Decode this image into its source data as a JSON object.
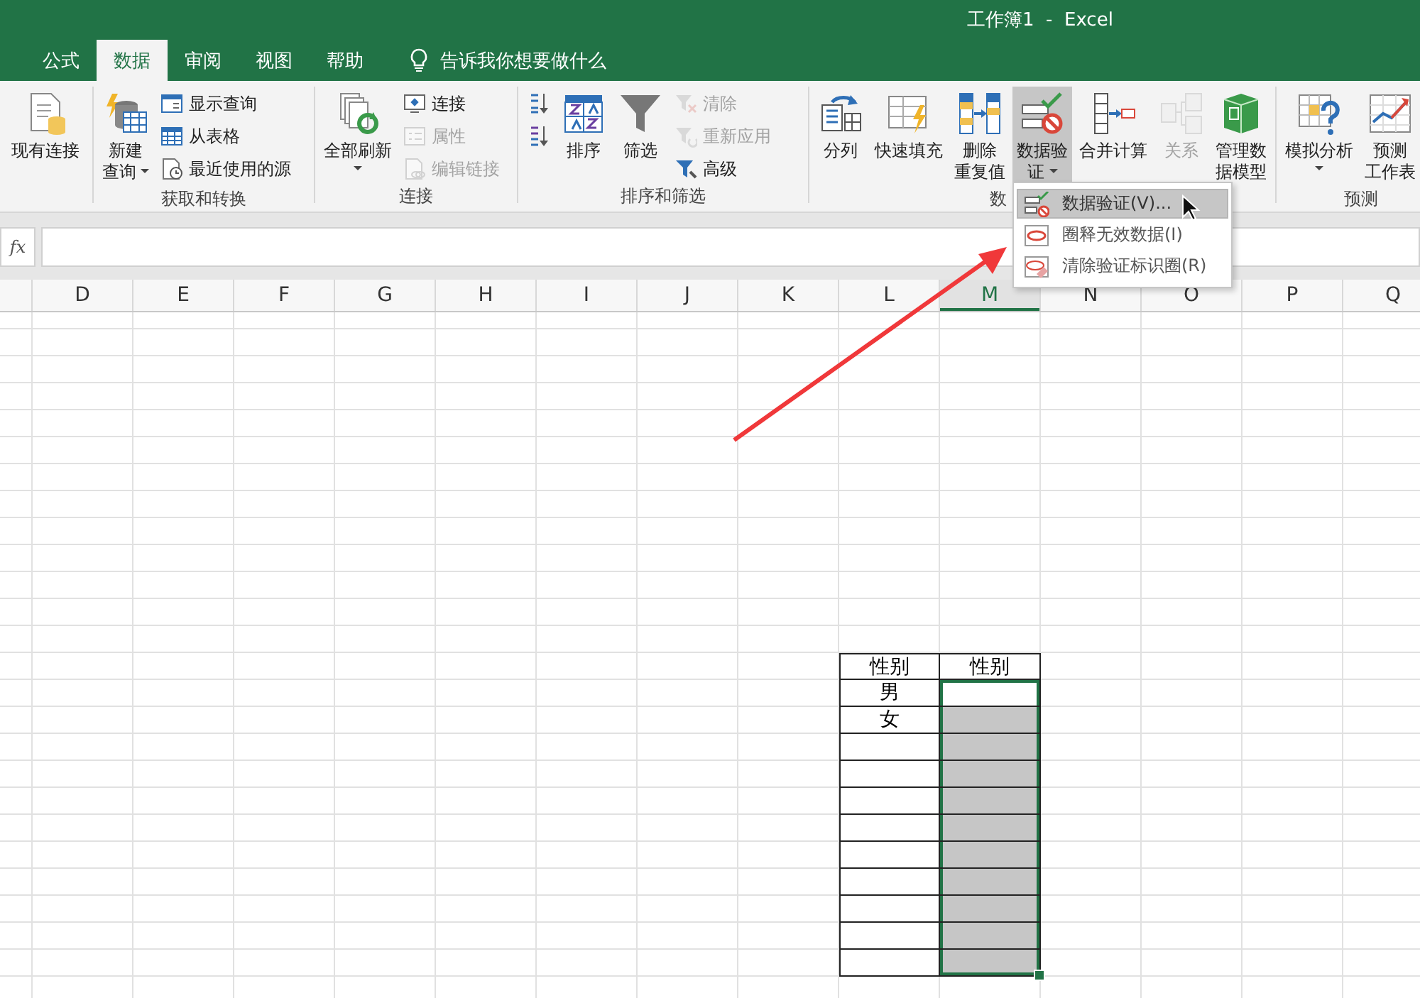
{
  "window": {
    "title": "工作簿1  -  Excel"
  },
  "tabs": [
    {
      "label": "公式",
      "selected": false
    },
    {
      "label": "数据",
      "selected": true
    },
    {
      "label": "审阅",
      "selected": false
    },
    {
      "label": "视图",
      "selected": false
    },
    {
      "label": "帮助",
      "selected": false
    }
  ],
  "tell_me": {
    "label": "告诉我你想要做什么"
  },
  "ribbon": {
    "groups": [
      {
        "items": [
          {
            "kind": "large",
            "lines": [
              "现有连接"
            ],
            "disabled": false,
            "pressed": false
          }
        ]
      },
      {
        "label": "获取和转换",
        "items": [
          {
            "kind": "large",
            "lines": [
              "新建",
              "查询"
            ],
            "dropdown": true,
            "disabled": false,
            "pressed": false
          },
          {
            "kind": "small",
            "label": "显示查询",
            "disabled": false,
            "pressed": false
          },
          {
            "kind": "small",
            "label": "从表格",
            "disabled": false,
            "pressed": false
          },
          {
            "kind": "small",
            "label": "最近使用的源",
            "disabled": false,
            "pressed": false
          }
        ]
      },
      {
        "label": "连接",
        "items": [
          {
            "kind": "large",
            "lines": [
              "全部刷新"
            ],
            "dropdown": true,
            "disabled": false,
            "pressed": false
          },
          {
            "kind": "small",
            "label": "连接",
            "disabled": false,
            "pressed": false
          },
          {
            "kind": "small",
            "label": "属性",
            "disabled": true,
            "pressed": false
          },
          {
            "kind": "small",
            "label": "编辑链接",
            "disabled": true,
            "pressed": false
          }
        ]
      },
      {
        "label": "排序和筛选",
        "items": [
          {
            "kind": "small",
            "disabled": false,
            "pressed": false
          },
          {
            "kind": "small",
            "disabled": false,
            "pressed": false
          },
          {
            "kind": "large",
            "lines": [
              "排序"
            ],
            "disabled": false,
            "pressed": false
          },
          {
            "kind": "large",
            "lines": [
              "筛选"
            ],
            "disabled": false,
            "pressed": false
          },
          {
            "kind": "small",
            "label": "清除",
            "disabled": true,
            "pressed": false
          },
          {
            "kind": "small",
            "label": "重新应用",
            "disabled": true,
            "pressed": false
          },
          {
            "kind": "small",
            "label": "高级",
            "disabled": false,
            "pressed": false
          }
        ]
      },
      {
        "label": "数",
        "items": [
          {
            "kind": "large",
            "lines": [
              "分列"
            ],
            "disabled": false,
            "pressed": false
          },
          {
            "kind": "large",
            "lines": [
              "快速填充"
            ],
            "disabled": false,
            "pressed": false
          },
          {
            "kind": "large",
            "lines": [
              "删除",
              "重复值"
            ],
            "disabled": false,
            "pressed": false
          },
          {
            "kind": "large",
            "lines": [
              "数据验",
              "证"
            ],
            "dropdown": true,
            "disabled": false,
            "pressed": true
          },
          {
            "kind": "large",
            "lines": [
              "合并计算"
            ],
            "disabled": false,
            "pressed": false
          },
          {
            "kind": "large",
            "lines": [
              "关系"
            ],
            "disabled": true,
            "pressed": false
          },
          {
            "kind": "large",
            "lines": [
              "管理数",
              "据模型"
            ],
            "disabled": false,
            "pressed": false
          }
        ]
      },
      {
        "label": "预测",
        "items": [
          {
            "kind": "large",
            "lines": [
              "模拟分析"
            ],
            "dropdown": true,
            "disabled": false,
            "pressed": false
          },
          {
            "kind": "large",
            "lines": [
              "预测",
              "工作表"
            ],
            "disabled": false,
            "pressed": false
          }
        ]
      }
    ]
  },
  "formula_bar": {
    "label": "fx"
  },
  "columns": [
    {
      "label": "D",
      "selected": false
    },
    {
      "label": "E",
      "selected": false
    },
    {
      "label": "F",
      "selected": false
    },
    {
      "label": "G",
      "selected": false
    },
    {
      "label": "H",
      "selected": false
    },
    {
      "label": "I",
      "selected": false
    },
    {
      "label": "J",
      "selected": false
    },
    {
      "label": "K",
      "selected": false
    },
    {
      "label": "L",
      "selected": false
    },
    {
      "label": "M",
      "selected": true
    },
    {
      "label": "N",
      "selected": false
    },
    {
      "label": "O",
      "selected": false
    },
    {
      "label": "P",
      "selected": false
    },
    {
      "label": "Q",
      "selected": false
    }
  ],
  "table": {
    "headers": [
      "性别",
      "性别"
    ],
    "rows": [
      {
        "column_1": "男",
        "selected": true,
        "active": true
      },
      {
        "column_1": "女",
        "selected": true,
        "active": false
      },
      {
        "selected": true,
        "active": false
      },
      {
        "selected": true,
        "active": false
      },
      {
        "selected": true,
        "active": false
      },
      {
        "selected": true,
        "active": false
      },
      {
        "selected": true,
        "active": false
      },
      {
        "selected": true,
        "active": false
      },
      {
        "selected": true,
        "active": false
      },
      {
        "selected": true,
        "active": false
      },
      {
        "selected": true,
        "active": false
      }
    ]
  },
  "menu": {
    "items": [
      {
        "label": "数据验证(V)...",
        "selected": true
      },
      {
        "label": "圈释无效数据(I)",
        "selected": false
      },
      {
        "label": "清除验证标识圈(R)",
        "selected": false
      }
    ]
  }
}
